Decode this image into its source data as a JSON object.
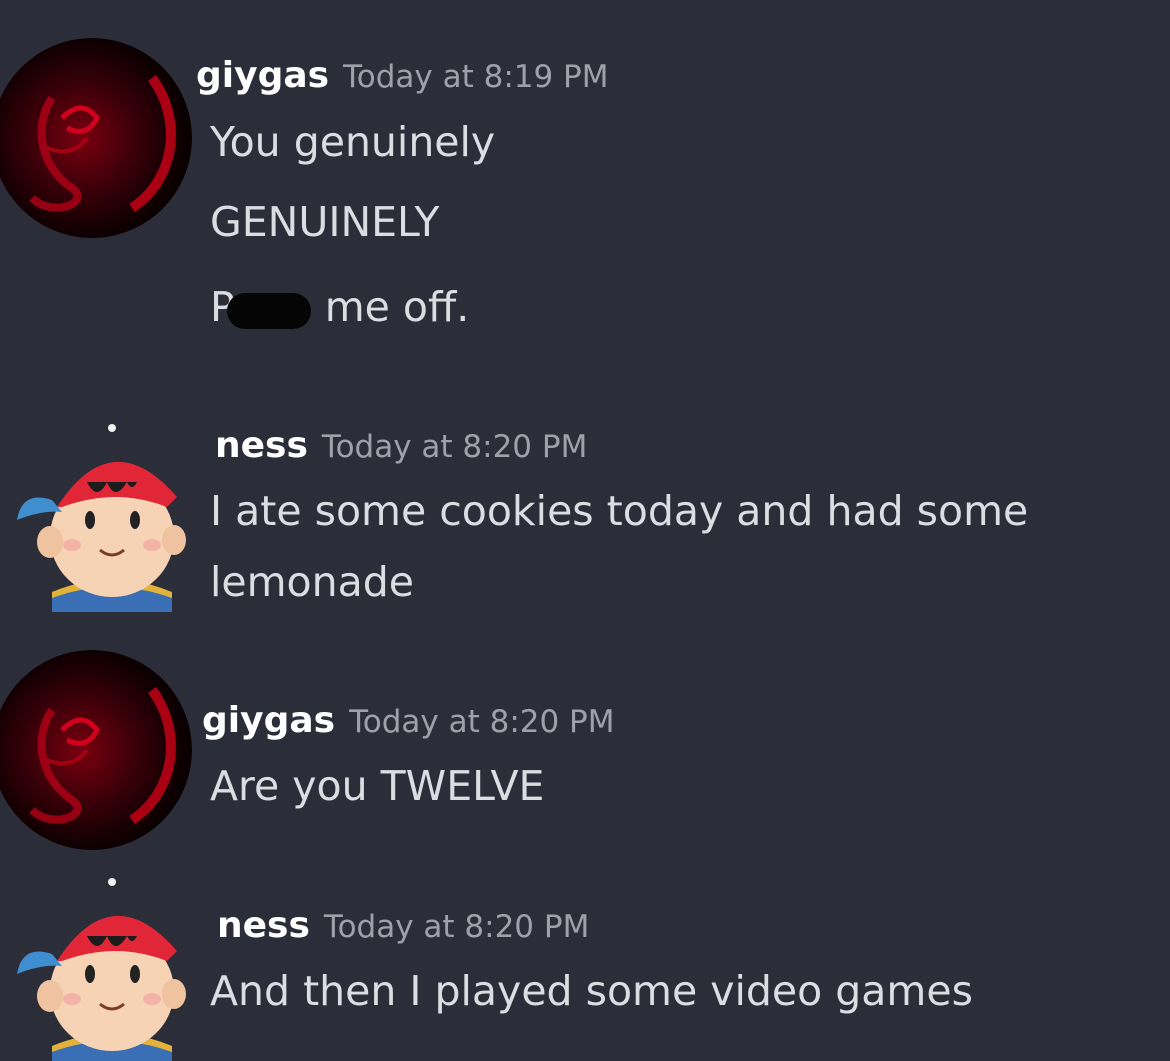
{
  "messages": [
    {
      "author": "giygas",
      "timestamp": "Today at 8:19 PM",
      "avatar": "giygas-avatar",
      "lines": [
        "You genuinely",
        "GENUINELY"
      ],
      "redacted_line": {
        "prefix": "P",
        "suffix": "me off."
      }
    },
    {
      "author": "ness",
      "timestamp": "Today at 8:20 PM",
      "avatar": "ness-avatar",
      "lines": [
        "I ate some cookies today and had some",
        "lemonade"
      ]
    },
    {
      "author": "giygas",
      "timestamp": "Today at 8:20 PM",
      "avatar": "giygas-avatar",
      "lines": [
        "Are you TWELVE"
      ]
    },
    {
      "author": "ness",
      "timestamp": "Today at 8:20 PM",
      "avatar": "ness-avatar",
      "lines": [
        "And then I played some video games"
      ]
    }
  ],
  "colors": {
    "background": "#2b2d38",
    "username": "#ffffff",
    "timestamp": "#9fa1aa",
    "message_text": "#dcdde3"
  }
}
